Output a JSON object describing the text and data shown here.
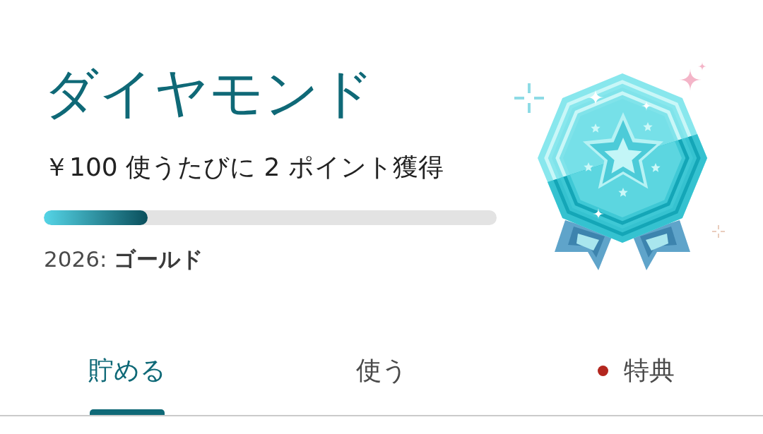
{
  "membership": {
    "tier": "ダイヤモンド",
    "earn_rate": "￥100 使うたびに 2 ポイント獲得",
    "progress": {
      "level": 0.23
    },
    "next_year_tier": "2026: **ゴールド**"
  },
  "tabs": [
    {
      "label": "貯める",
      "selected": true,
      "notification_dot": false
    },
    {
      "label": "使う",
      "selected": false,
      "notification_dot": false
    },
    {
      "label": "特典",
      "selected": false,
      "notification_dot": true
    }
  ]
}
